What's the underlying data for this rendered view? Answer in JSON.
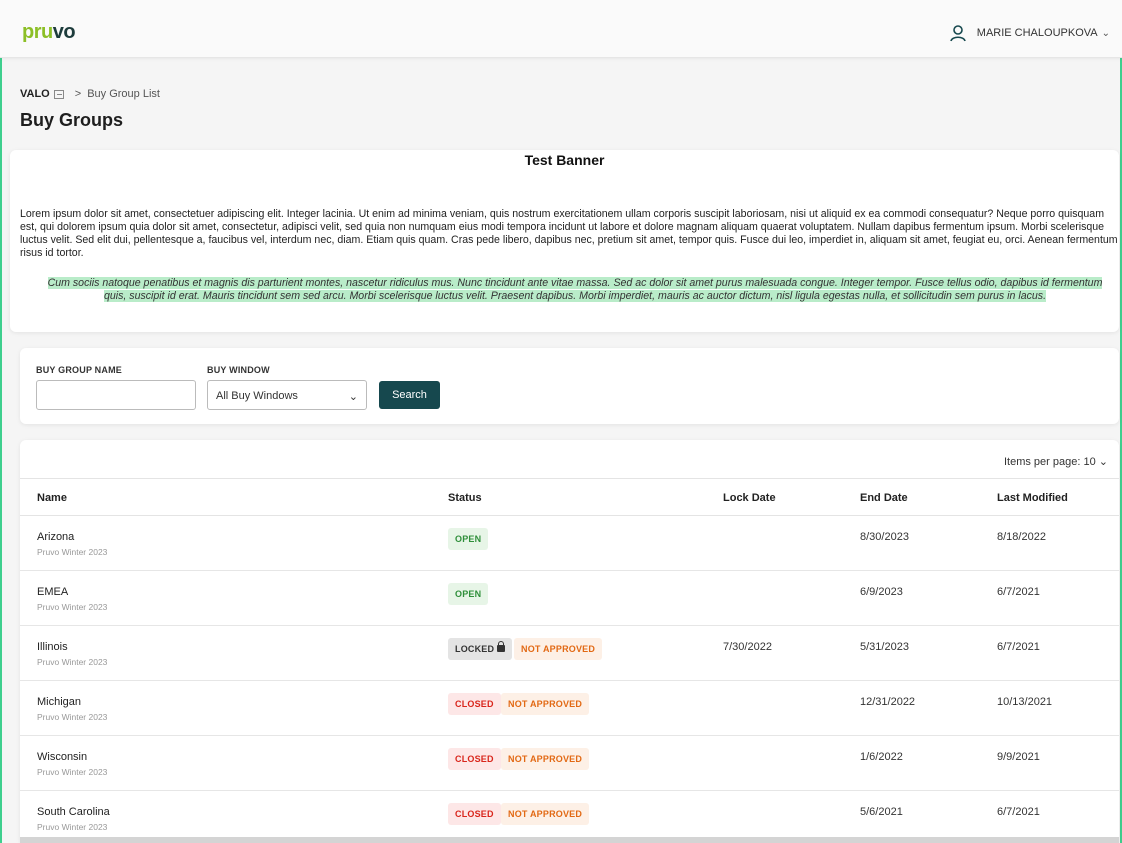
{
  "app": {
    "logo_part1": "pru",
    "logo_part2": "vo",
    "user_name": "MARIE CHALOUPKOVA"
  },
  "breadcrumb": {
    "root": "VALO",
    "separator": ">",
    "current": "Buy Group List"
  },
  "page_title": "Buy Groups",
  "banner": {
    "title": "Test Banner",
    "body": "Lorem ipsum dolor sit amet, consectetuer adipiscing elit. Integer lacinia. Ut enim ad minima veniam, quis nostrum exercitationem ullam corporis suscipit laboriosam, nisi ut aliquid ex ea commodi consequatur? Neque porro quisquam est, qui dolorem ipsum quia dolor sit amet, consectetur, adipisci velit, sed quia non numquam eius modi tempora incidunt ut labore et dolore magnam aliquam quaerat voluptatem. Nullam dapibus fermentum ipsum. Morbi scelerisque luctus velit. Sed elit dui, pellentesque a, faucibus vel, interdum nec, diam. Etiam quis quam. Cras pede libero, dapibus nec, pretium sit amet, tempor quis. Fusce dui leo, imperdiet in, aliquam sit amet, feugiat eu, orci. Aenean fermentum risus id tortor.",
    "highlight": "Cum sociis natoque penatibus et magnis dis parturient montes, nascetur ridiculus mus. Nunc tincidunt ante vitae massa. Sed ac dolor sit amet purus malesuada congue. Integer tempor. Fusce tellus odio, dapibus id fermentum quis, suscipit id erat. Mauris tincidunt sem sed arcu. Morbi scelerisque luctus velit. Praesent dapibus. Morbi imperdiet, mauris ac auctor dictum, nisl ligula egestas nulla, et sollicitudin sem purus in lacus."
  },
  "filters": {
    "name_label": "BUY GROUP NAME",
    "name_value": "",
    "window_label": "BUY WINDOW",
    "window_selected": "All Buy Windows",
    "search_label": "Search"
  },
  "table": {
    "items_per_page_label": "Items per page: 10",
    "headers": {
      "name": "Name",
      "status": "Status",
      "lock_date": "Lock Date",
      "end_date": "End Date",
      "last_modified": "Last Modified"
    },
    "rows": [
      {
        "name": "Arizona",
        "sub": "Pruvo Winter 2023",
        "status1": "OPEN",
        "status2": "",
        "lock_date": "",
        "end_date": "8/30/2023",
        "last_modified": "8/18/2022"
      },
      {
        "name": "EMEA",
        "sub": "Pruvo Winter 2023",
        "status1": "OPEN",
        "status2": "",
        "lock_date": "",
        "end_date": "6/9/2023",
        "last_modified": "6/7/2021"
      },
      {
        "name": "Illinois",
        "sub": "Pruvo Winter 2023",
        "status1": "LOCKED",
        "status2": "NOT APPROVED",
        "lock_date": "7/30/2022",
        "end_date": "5/31/2023",
        "last_modified": "6/7/2021"
      },
      {
        "name": "Michigan",
        "sub": "Pruvo Winter 2023",
        "status1": "CLOSED",
        "status2": "NOT APPROVED",
        "lock_date": "",
        "end_date": "12/31/2022",
        "last_modified": "10/13/2021"
      },
      {
        "name": "Wisconsin",
        "sub": "Pruvo Winter 2023",
        "status1": "CLOSED",
        "status2": "NOT APPROVED",
        "lock_date": "",
        "end_date": "1/6/2022",
        "last_modified": "9/9/2021"
      },
      {
        "name": "South Carolina",
        "sub": "Pruvo Winter 2023",
        "status1": "CLOSED",
        "status2": "NOT APPROVED",
        "lock_date": "",
        "end_date": "5/6/2021",
        "last_modified": "6/7/2021"
      }
    ]
  },
  "colors": {
    "accent": "#16484e",
    "logo_green": "#8cbf26",
    "open": "#2f8f3a",
    "closed": "#d9261c",
    "not_approved": "#e26914"
  }
}
